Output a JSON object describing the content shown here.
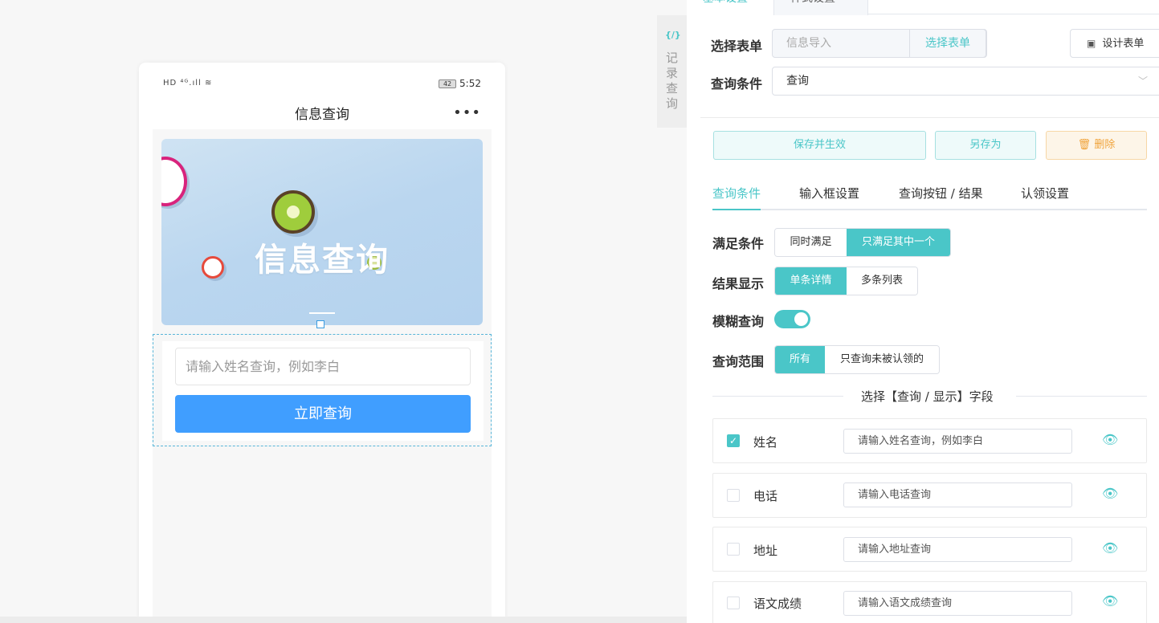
{
  "colors": {
    "accent": "#4ac6c8",
    "primary_button": "#409eff",
    "warning": "#f0a33a"
  },
  "preview": {
    "status_left": "HD ⁴ᴳ.ıll ≋",
    "battery": "42",
    "time": "5:52",
    "nav_title": "信息查询",
    "nav_more": "•••",
    "banner_title": "信息查询",
    "input_placeholder": "请输入姓名查询，例如李白",
    "query_button": "立即查询"
  },
  "side_tab": {
    "icon": "{/}",
    "label": "记录查询"
  },
  "panel": {
    "top_tabs": [
      "基本设置",
      "样式设置"
    ],
    "select_form_label": "选择表单",
    "select_form_value": "信息导入",
    "select_form_button": "选择表单",
    "design_form_button": "设计表单",
    "query_condition_label": "查询条件",
    "query_condition_value": "查询",
    "actions": {
      "save": "保存并生效",
      "save_as": "另存为",
      "delete": "删除"
    },
    "sub_tabs": [
      "查询条件",
      "输入框设置",
      "查询按钮 / 结果",
      "认领设置"
    ],
    "satisfy_label": "满足条件",
    "satisfy_options": [
      "同时满足",
      "只满足其中一个"
    ],
    "result_label": "结果显示",
    "result_options": [
      "单条详情",
      "多条列表"
    ],
    "fuzzy_label": "模糊查询",
    "scope_label": "查询范围",
    "scope_options": [
      "所有",
      "只查询未被认领的"
    ],
    "field_section_title": "选择【查询 / 显示】字段",
    "fields": [
      {
        "name": "姓名",
        "placeholder": "请输入姓名查询，例如李白",
        "checked": true
      },
      {
        "name": "电话",
        "placeholder": "请输入电话查询",
        "checked": false
      },
      {
        "name": "地址",
        "placeholder": "请输入地址查询",
        "checked": false
      },
      {
        "name": "语文成绩",
        "placeholder": "请输入语文成绩查询",
        "checked": false
      }
    ]
  }
}
